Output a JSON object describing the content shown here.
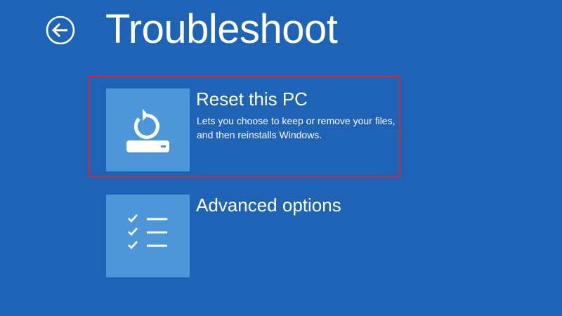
{
  "header": {
    "back_icon": "back-arrow-circle-icon",
    "title": "Troubleshoot"
  },
  "options": [
    {
      "icon": "reset-pc-icon",
      "title": "Reset this PC",
      "description": "Lets you choose to keep or remove your files, and then reinstalls Windows."
    },
    {
      "icon": "checklist-icon",
      "title": "Advanced options"
    }
  ],
  "colors": {
    "background": "#1e63b6",
    "tile": "#4d96d8",
    "text": "#ffffff",
    "highlight": "#d82734"
  }
}
